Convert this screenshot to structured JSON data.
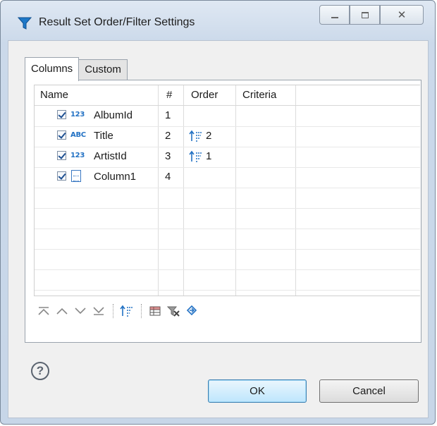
{
  "window": {
    "title": "Result Set Order/Filter Settings",
    "icon": "filter-icon",
    "controls": [
      "minimize",
      "maximize",
      "close"
    ]
  },
  "tabs": [
    {
      "label": "Columns",
      "active": true
    },
    {
      "label": "Custom",
      "active": false
    }
  ],
  "grid": {
    "headers": {
      "name": "Name",
      "num": "#",
      "order": "Order",
      "criteria": "Criteria"
    },
    "rows": [
      {
        "checked": true,
        "type_icon": "123",
        "type": "numeric",
        "name": "AlbumId",
        "num": "1",
        "order": ""
      },
      {
        "checked": true,
        "type_icon": "ABC",
        "type": "text",
        "name": "Title",
        "num": "2",
        "order": "2"
      },
      {
        "checked": true,
        "type_icon": "123",
        "type": "numeric",
        "name": "ArtistId",
        "num": "3",
        "order": "1"
      },
      {
        "checked": true,
        "type_icon": "",
        "type": "document",
        "name": "Column1",
        "num": "4",
        "order": ""
      }
    ]
  },
  "toolbar": [
    "move-top-icon",
    "move-up-icon",
    "move-down-icon",
    "move-bottom-icon",
    "sort-icon",
    "table-settings-icon",
    "remove-filter-icon",
    "reset-icon"
  ],
  "buttons": {
    "ok": "OK",
    "cancel": "Cancel"
  },
  "colors": {
    "accent": "#2372c4",
    "title_bg": "#cbd9ea",
    "ok_bg": "#bee6fd"
  }
}
